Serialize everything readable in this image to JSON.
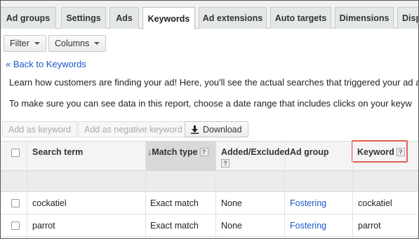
{
  "tabs": [
    {
      "label": "Ad groups"
    },
    {
      "label": "Settings"
    },
    {
      "label": "Ads"
    },
    {
      "label": "Keywords"
    },
    {
      "label": "Ad extensions"
    },
    {
      "label": "Auto targets"
    },
    {
      "label": "Dimensions"
    },
    {
      "label": "Disp"
    }
  ],
  "toolbar": {
    "filter_label": "Filter",
    "columns_label": "Columns",
    "add_keyword_label": "Add as keyword",
    "add_negative_label": "Add as negative keyword",
    "download_label": "Download"
  },
  "back_link": "« Back to Keywords",
  "description": {
    "line1": "Learn how customers are finding your ad! Here, you'll see the actual searches that triggered your ad a",
    "line2": "To make sure you can see data in this report, choose a date range that includes clicks on your keyw"
  },
  "table": {
    "headers": {
      "search_term": "Search term",
      "match_type": "Match type",
      "added_excluded": "Added/Excluded",
      "ad_group": "Ad group",
      "keyword": "Keyword"
    },
    "help_glyph": "?",
    "sort_arrow": "↓",
    "rows": [
      {
        "search_term": "cockatiel",
        "match_type": "Exact match",
        "added_excluded": "None",
        "ad_group": "Fostering",
        "keyword": "cockatiel"
      },
      {
        "search_term": "parrot",
        "match_type": "Exact match",
        "added_excluded": "None",
        "ad_group": "Fostering",
        "keyword": "parrot"
      }
    ]
  },
  "colors": {
    "link": "#1a56cc",
    "highlight": "#e6604e",
    "sorted_column": "#d9d9d9"
  }
}
